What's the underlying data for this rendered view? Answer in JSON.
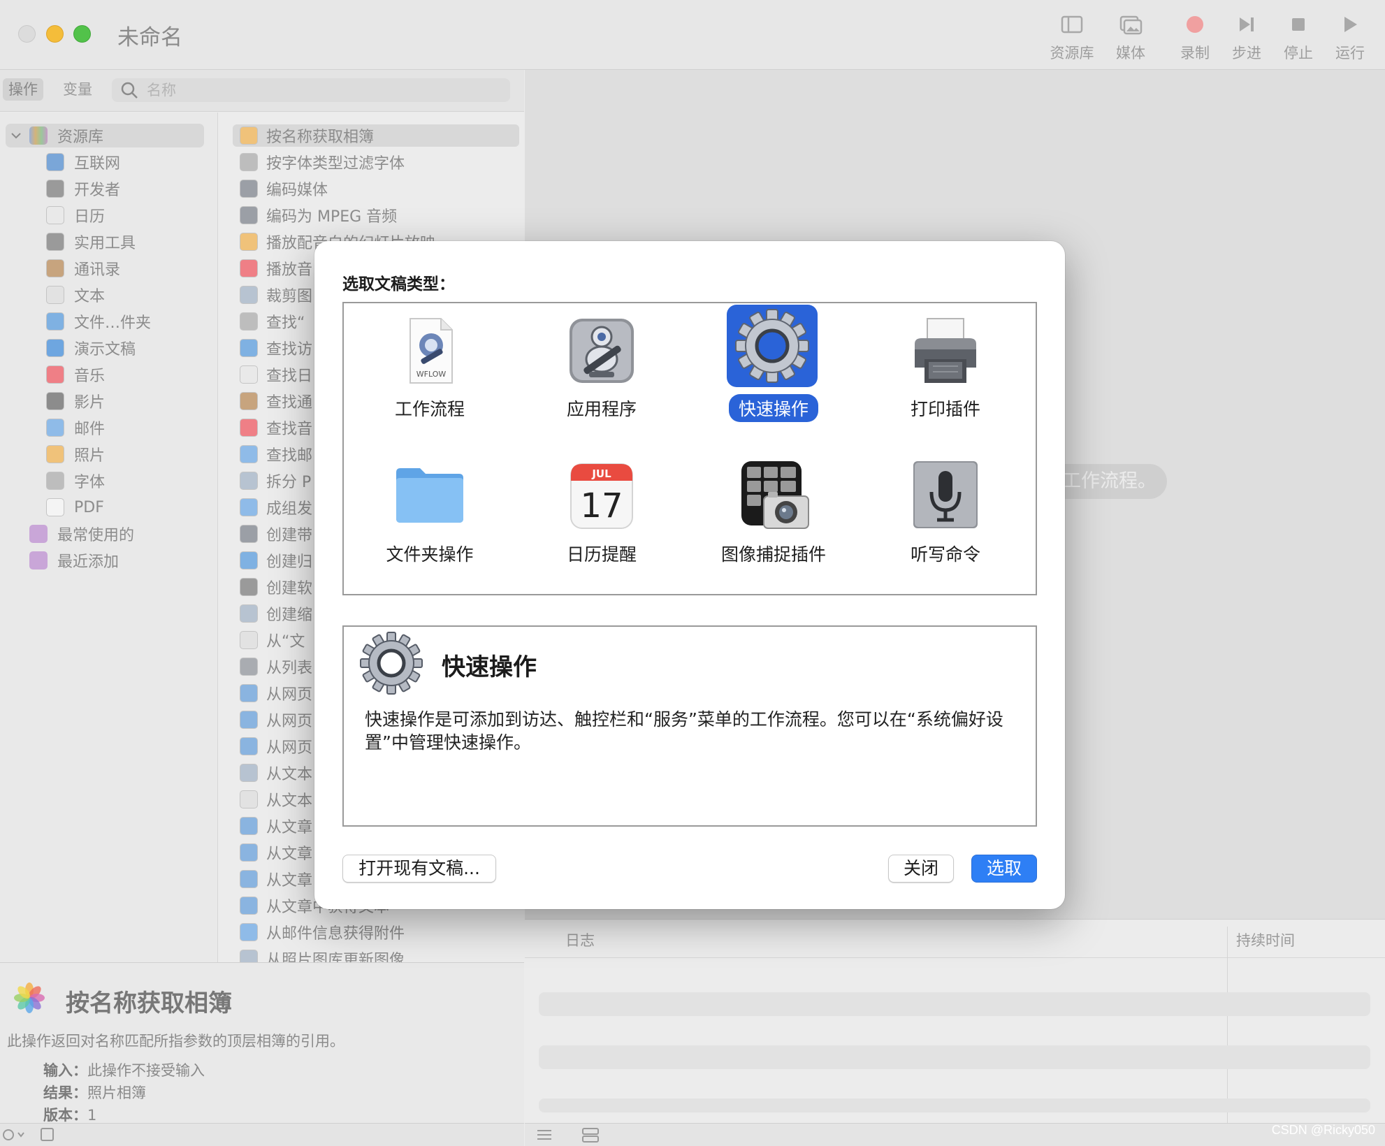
{
  "window": {
    "title": "未命名",
    "toolbar": {
      "library": "资源库",
      "media": "媒体",
      "record": "录制",
      "step": "步进",
      "stop": "停止",
      "run": "运行"
    }
  },
  "sidebar": {
    "segments": {
      "actions": "操作",
      "variables": "变量"
    },
    "search": {
      "placeholder": "名称"
    },
    "library_root": "资源库",
    "library_items": [
      {
        "label": "互联网",
        "icon": "globe-icon"
      },
      {
        "label": "开发者",
        "icon": "tools-icon"
      },
      {
        "label": "日历",
        "icon": "calendar-icon"
      },
      {
        "label": "实用工具",
        "icon": "tools-icon"
      },
      {
        "label": "通讯录",
        "icon": "contacts-icon"
      },
      {
        "label": "文本",
        "icon": "text-icon"
      },
      {
        "label": "文件…件夹",
        "icon": "finder-icon"
      },
      {
        "label": "演示文稿",
        "icon": "keynote-icon"
      },
      {
        "label": "音乐",
        "icon": "music-icon"
      },
      {
        "label": "影片",
        "icon": "movie-icon"
      },
      {
        "label": "邮件",
        "icon": "mail-icon"
      },
      {
        "label": "照片",
        "icon": "photos-icon"
      },
      {
        "label": "字体",
        "icon": "font-icon"
      },
      {
        "label": "PDF",
        "icon": "pdf-icon"
      }
    ],
    "smart_groups": [
      {
        "label": "最常使用的",
        "icon": "folder-icon"
      },
      {
        "label": "最近添加",
        "icon": "folder-icon"
      }
    ]
  },
  "actions_list": [
    {
      "label": "按名称获取相簿",
      "icon": "photos-icon"
    },
    {
      "label": "按字体类型过滤字体",
      "icon": "font-icon"
    },
    {
      "label": "编码媒体",
      "icon": "quicktime-icon"
    },
    {
      "label": "编码为 MPEG 音频",
      "icon": "quicktime-icon"
    },
    {
      "label": "播放配音白的幻灯片放映",
      "icon": "photos-icon"
    },
    {
      "label": "播放音",
      "icon": "music-icon"
    },
    {
      "label": "裁剪图",
      "icon": "preview-icon"
    },
    {
      "label": "查找“",
      "icon": "font-icon"
    },
    {
      "label": "查找访",
      "icon": "finder-icon"
    },
    {
      "label": "查找日",
      "icon": "calendar-icon"
    },
    {
      "label": "查找通",
      "icon": "contacts-icon"
    },
    {
      "label": "查找音",
      "icon": "music-icon"
    },
    {
      "label": "查找邮",
      "icon": "mail-icon"
    },
    {
      "label": "拆分 P",
      "icon": "preview-icon"
    },
    {
      "label": "成组发",
      "icon": "mail-icon"
    },
    {
      "label": "创建带",
      "icon": "quicktime-icon"
    },
    {
      "label": "创建归",
      "icon": "finder-icon"
    },
    {
      "label": "创建软",
      "icon": "tools-icon"
    },
    {
      "label": "创建缩",
      "icon": "preview-icon"
    },
    {
      "label": "从“文",
      "icon": "text-icon"
    },
    {
      "label": "从列表",
      "icon": "automator-icon"
    },
    {
      "label": "从网页",
      "icon": "safari-icon"
    },
    {
      "label": "从网页",
      "icon": "safari-icon"
    },
    {
      "label": "从网页",
      "icon": "safari-icon"
    },
    {
      "label": "从文本",
      "icon": "preview-icon"
    },
    {
      "label": "从文本",
      "icon": "text-icon"
    },
    {
      "label": "从文章",
      "icon": "safari-icon"
    },
    {
      "label": "从文章",
      "icon": "safari-icon"
    },
    {
      "label": "从文章",
      "icon": "safari-icon"
    },
    {
      "label": "从文章中获得文本",
      "icon": "safari-icon"
    },
    {
      "label": "从邮件信息获得附件",
      "icon": "mail-icon"
    },
    {
      "label": "从照片图库更新图像",
      "icon": "preview-icon"
    }
  ],
  "info_pane": {
    "title": "按名称获取相簿",
    "description": "此操作返回对名称匹配所指参数的顶层相簿的引用。",
    "input_label": "输入：",
    "input_value": "此操作不接受输入",
    "result_label": "结果：",
    "result_value": "照片相簿",
    "version_label": "版本：",
    "version_value": "1"
  },
  "workflow": {
    "drop_hint": "工作流程。"
  },
  "log": {
    "col_log": "日志",
    "col_duration": "持续时间"
  },
  "dialog": {
    "heading": "选取文稿类型：",
    "types": [
      {
        "label": "工作流程",
        "icon": "workflow-file-icon",
        "selected": false
      },
      {
        "label": "应用程序",
        "icon": "automator-robot-icon",
        "selected": false
      },
      {
        "label": "快速操作",
        "icon": "gear-icon",
        "selected": true
      },
      {
        "label": "打印插件",
        "icon": "printer-icon",
        "selected": false
      },
      {
        "label": "文件夹操作",
        "icon": "folder-icon",
        "selected": false
      },
      {
        "label": "日历提醒",
        "icon": "calendar-icon",
        "selected": false
      },
      {
        "label": "图像捕捉插件",
        "icon": "image-capture-icon",
        "selected": false
      },
      {
        "label": "听写命令",
        "icon": "microphone-icon",
        "selected": false
      }
    ],
    "workflow_file_tag": "WFLOW",
    "calendar_month": "JUL",
    "calendar_day": "17",
    "description_title": "快速操作",
    "description_text": "快速操作是可添加到访达、触控栏和“服务”菜单的工作流程。您可以在“系统偏好设置”中管理快速操作。",
    "buttons": {
      "open": "打开现有文稿...",
      "close": "关闭",
      "choose": "选取"
    }
  },
  "watermark": "CSDN @Ricky050",
  "colors": {
    "accent": "#2e7ff5",
    "selection": "#2a63d8"
  }
}
